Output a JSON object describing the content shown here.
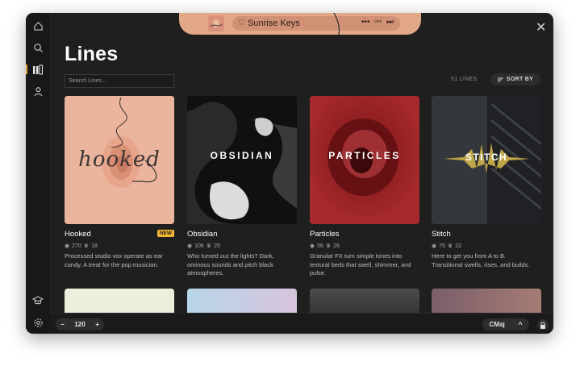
{
  "now_playing": {
    "title": "Sunrise Keys",
    "favorite_icon": "heart-icon",
    "more_label": "•••",
    "prev_label": "⏮",
    "next_label": "⏭"
  },
  "sidebar": {
    "items": [
      {
        "name": "home",
        "icon": "home-icon"
      },
      {
        "name": "search",
        "icon": "search-icon"
      },
      {
        "name": "library",
        "icon": "library-icon",
        "active": true
      },
      {
        "name": "profile",
        "icon": "user-icon"
      },
      {
        "name": "learn",
        "icon": "graduation-cap-icon"
      },
      {
        "name": "settings",
        "icon": "gear-icon"
      }
    ],
    "accent_color": "#e8a33a"
  },
  "page": {
    "title": "Lines",
    "search_placeholder": "Search Lines...",
    "count_label": "51 LINES",
    "sort_label": "SORT BY"
  },
  "cards": [
    {
      "name": "Hooked",
      "badge": "NEW",
      "stat1": "270",
      "stat2": "18",
      "description": "Processed studio vox operate as ear candy. A treat for the pop musician.",
      "art_text": "hooked"
    },
    {
      "name": "Obsidian",
      "stat1": "106",
      "stat2": "25",
      "description": "Who turned out the lights? Dark, ominous sounds and pitch black atmospheres.",
      "art_text": "OBSIDIAN"
    },
    {
      "name": "Particles",
      "stat1": "56",
      "stat2": "26",
      "description": "Granular FX turn simple tones into textural beds that swell, shimmer, and pulse.",
      "art_text": "PARTICLES"
    },
    {
      "name": "Stitch",
      "stat1": "75",
      "stat2": "22",
      "description": "Here to get you from A to B. Transitional swells, rises, and builds.",
      "art_text": "STITCH"
    }
  ],
  "bottom": {
    "tempo": "120",
    "tempo_minus": "−",
    "tempo_plus": "+",
    "key": "CMaj",
    "key_caret": "^"
  },
  "colors": {
    "badge": "#f2b632",
    "now_playing_tab": "#e3a887",
    "background": "#1f1f1f"
  }
}
